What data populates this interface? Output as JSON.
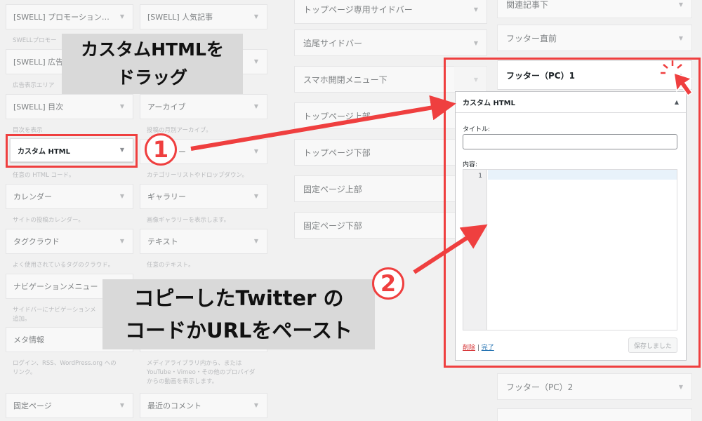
{
  "colors": {
    "accent_red": "#ef3f3f",
    "callout_bg": "#d9d9d9"
  },
  "left_col_a": [
    {
      "label": "[SWELL] プロモーション…",
      "desc": "SWELLプロモー"
    },
    {
      "label": "[SWELL] 広告",
      "desc": "広告表示エリア"
    },
    {
      "label": "[SWELL] 目次",
      "desc": "目次を表示"
    },
    {
      "label": "カスタム HTML",
      "desc": "任意の HTML コード。"
    },
    {
      "label": "カレンダー",
      "desc": "サイトの投稿カレンダー。"
    },
    {
      "label": "タグクラウド",
      "desc": "よく使用されているタグのクラウド。"
    },
    {
      "label": "ナビゲーションメニュー",
      "desc": "サイドバーにナビゲーションメ",
      "desc2": "追加。"
    },
    {
      "label": "メタ情報",
      "desc": "ログイン、RSS、WordPress.org への",
      "desc2": "リンク。"
    },
    {
      "label": "固定ページ"
    }
  ],
  "left_col_b": [
    {
      "label": "[SWELL] 人気記事"
    },
    {
      "label": ""
    },
    {
      "label": "アーカイブ",
      "desc": "投稿の月別アーカイブ。"
    },
    {
      "label": "カテゴリー",
      "desc": "カテゴリーリストやドロップダウン。"
    },
    {
      "label": "ギャラリー",
      "desc": "画像ギャラリーを表示します。"
    },
    {
      "label": "テキスト",
      "desc": "任意のテキスト。"
    },
    {
      "label": ""
    },
    {
      "label": "",
      "desc": "メディアライブラリ内から、または",
      "desc2": "YouTube・Vimeo・その他のプロバイダ",
      "desc3": "からの動画を表示します。"
    },
    {
      "label": "最近のコメント"
    }
  ],
  "middle_areas": [
    "トップページ専用サイドバー",
    "追尾サイドバー",
    "スマホ開閉メニュー下",
    "トップページ上部",
    "トップページ下部",
    "固定ページ上部",
    "固定ページ下部"
  ],
  "right_areas": {
    "top1": "関連記事下",
    "top2": "フッター直前",
    "active": "フッター（PC）1",
    "after": "フッター（PC）2"
  },
  "widget": {
    "title": "カスタム HTML",
    "title_label": "タイトル:",
    "content_label": "内容:",
    "line_number": "1",
    "delete_label": "削除",
    "separator": " | ",
    "done_label": "完了",
    "saved_label": "保存しました"
  },
  "callouts": {
    "step1_line1": "カスタムHTMLを",
    "step1_line2": "ドラッグ",
    "step1_num": "1",
    "step2_line1": "コピーしたTwitter の",
    "step2_line2": "コードかURLをペースト",
    "step2_num": "2"
  }
}
